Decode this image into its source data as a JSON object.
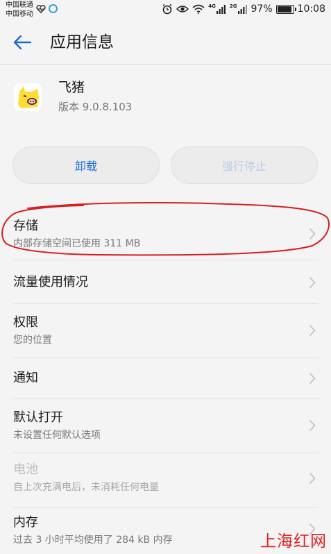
{
  "status_bar": {
    "carrier_1": "中国联通",
    "carrier_2": "中国移动",
    "net_tag_1": "4G",
    "net_tag_2": "2G",
    "battery_percent": "97%",
    "battery_level": 0.97,
    "time": "10:08"
  },
  "header": {
    "title": "应用信息"
  },
  "app": {
    "name": "飞猪",
    "version": "版本 9.0.8.103",
    "icon": "fliggy-pig-icon"
  },
  "buttons": {
    "uninstall": "卸载",
    "force_stop": "强行停止"
  },
  "list": [
    {
      "title": "存储",
      "subtitle": "内部存储空间已使用 311 MB",
      "enabled": true
    },
    {
      "title": "流量使用情况",
      "subtitle": "",
      "enabled": true
    },
    {
      "title": "权限",
      "subtitle": "您的位置",
      "enabled": true
    },
    {
      "title": "通知",
      "subtitle": "",
      "enabled": true
    },
    {
      "title": "默认打开",
      "subtitle": "未设置任何默认选项",
      "enabled": true
    },
    {
      "title": "电池",
      "subtitle": "自上次充满电后，未消耗任何电量",
      "enabled": false
    },
    {
      "title": "内存",
      "subtitle": "过去 3 小时平均使用了 284 kB 内存",
      "enabled": true
    }
  ],
  "watermark": "上海红网",
  "colors": {
    "accent": "#1a6bd2",
    "annotation": "#d42020",
    "watermark": "#e02020"
  }
}
